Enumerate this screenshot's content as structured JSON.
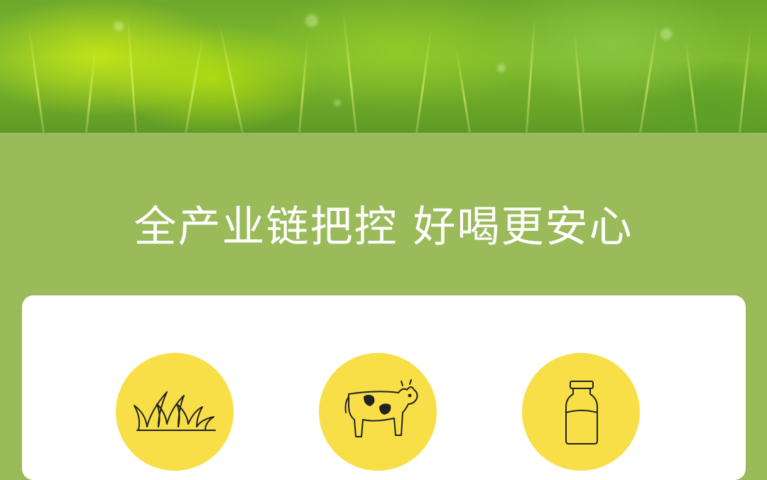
{
  "hero": {
    "image": "green-grass-banner"
  },
  "headline": {
    "text": "全产业链把控 好喝更安心"
  },
  "features": [
    {
      "icon": "grass-icon"
    },
    {
      "icon": "cow-icon"
    },
    {
      "icon": "milk-bottle-icon"
    }
  ],
  "colors": {
    "background": "#9bba5a",
    "card": "#ffffff",
    "circle": "#f8df48",
    "headline": "#ffffff",
    "icon_stroke": "#222222"
  }
}
